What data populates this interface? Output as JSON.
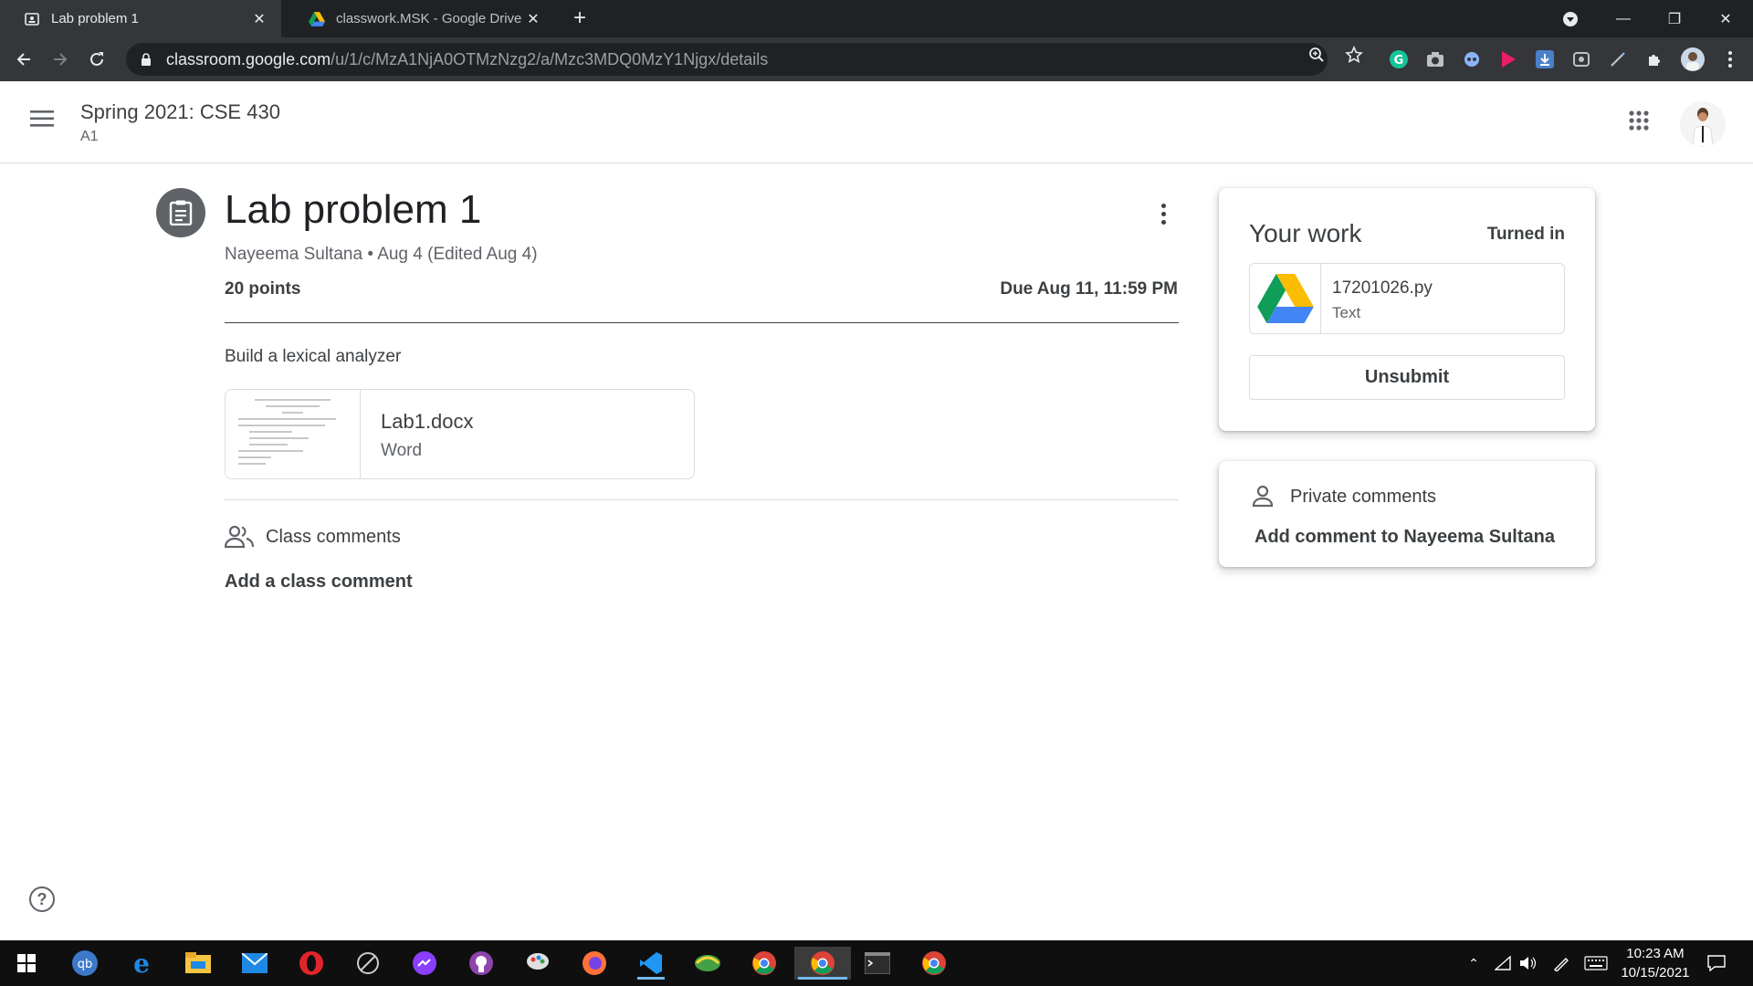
{
  "browser": {
    "tabs": [
      {
        "title": "Lab problem 1",
        "active": true
      },
      {
        "title": "classwork.MSK - Google Drive",
        "active": false
      }
    ],
    "url_host": "classroom.google.com",
    "url_path": "/u/1/c/MzA1NjA0OTMzNzg2/a/Mzc3MDQ0MzY1Njgx/details"
  },
  "header": {
    "course_title": "Spring 2021: CSE 430",
    "section": "A1"
  },
  "assignment": {
    "title": "Lab problem 1",
    "meta": "Nayeema Sultana • Aug 4 (Edited Aug 4)",
    "points": "20 points",
    "due": "Due Aug 11, 11:59 PM",
    "description": "Build a lexical analyzer",
    "attachment": {
      "name": "Lab1.docx",
      "type": "Word"
    }
  },
  "class_comments": {
    "label": "Class comments",
    "add": "Add a class comment"
  },
  "your_work": {
    "title": "Your work",
    "status": "Turned in",
    "file": {
      "name": "17201026.py",
      "type": "Text"
    },
    "unsubmit_label": "Unsubmit"
  },
  "private_comments": {
    "label": "Private comments",
    "add": "Add comment to Nayeema Sultana"
  },
  "taskbar": {
    "time": "10:23 AM",
    "date": "10/15/2021"
  },
  "colors": {
    "chrome_dark": "#202124",
    "chrome_toolbar": "#35363a",
    "text_primary": "#3c4043",
    "text_secondary": "#5f6368",
    "taskbar": "#0f0f0f"
  }
}
